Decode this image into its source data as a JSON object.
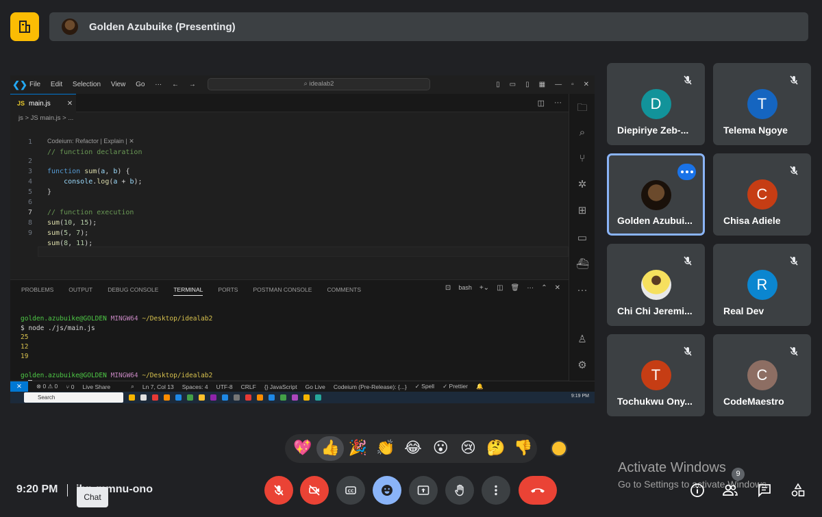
{
  "header": {
    "presenter_label": "Golden Azubuike (Presenting)"
  },
  "vscode": {
    "menu": [
      "File",
      "Edit",
      "Selection",
      "View",
      "Go",
      "···"
    ],
    "search": "idealab2",
    "tab_label": "main.js",
    "tab_badge": "JS",
    "breadcrumb": "js  >  JS  main.js  > ...",
    "codeium_lens": "Codeium: Refactor | Explain | ✕",
    "code_lines": [
      {
        "num": "1",
        "text": "// function declaration"
      },
      {
        "num": "2",
        "text": "function sum(a, b) {"
      },
      {
        "num": "3",
        "text": "    console.log(a + b);"
      },
      {
        "num": "4",
        "text": "}"
      },
      {
        "num": "5",
        "text": ""
      },
      {
        "num": "6",
        "text": "// function execution"
      },
      {
        "num": "7",
        "text": "sum(10, 15);"
      },
      {
        "num": "8",
        "text": "sum(5, 7);"
      },
      {
        "num": "9",
        "text": "sum(8, 11);"
      }
    ],
    "panel_tabs": [
      "PROBLEMS",
      "OUTPUT",
      "DEBUG CONSOLE",
      "TERMINAL",
      "PORTS",
      "POSTMAN CONSOLE",
      "COMMENTS"
    ],
    "panel_active_tab": "TERMINAL",
    "shell": "bash",
    "terminal": {
      "user": "golden.azubuike@GOLDEN",
      "env": "MINGW64",
      "path": "~/Desktop/idealab2",
      "command": "$ node ./js/main.js",
      "outputs": [
        "25",
        "12",
        "19"
      ],
      "prompt": "$"
    },
    "status_items": [
      "⊗ 0 ⚠ 0",
      "⑂ 0",
      "Live Share",
      "Ln 7, Col 13",
      "Spaces: 4",
      "UTF-8",
      "CRLF",
      "{} JavaScript",
      "Go Live",
      "Codeium (Pre-Release): {...}",
      "✓ Spell",
      "✓ Prettier"
    ],
    "taskbar_search": "Search",
    "taskbar_time": "9:19 PM"
  },
  "participants": [
    {
      "name": "Diepiriye Zeb-...",
      "initial": "D",
      "color": "#12939a",
      "muted": true
    },
    {
      "name": "Telema Ngoye",
      "initial": "T",
      "color": "#1565c0",
      "muted": true
    },
    {
      "name": "Golden Azubui...",
      "initial": "",
      "color": "#2b1a0e",
      "muted": false,
      "active": true
    },
    {
      "name": "Chisa Adiele",
      "initial": "C",
      "color": "#c63d14",
      "muted": true
    },
    {
      "name": "Chi Chi Jeremi...",
      "initial": "",
      "color": "#e8e8e8",
      "muted": true
    },
    {
      "name": "Real Dev",
      "initial": "R",
      "color": "#0b86d0",
      "muted": true
    },
    {
      "name": "Tochukwu Ony...",
      "initial": "T",
      "color": "#c63d14",
      "muted": true
    },
    {
      "name": "CodeMaestro",
      "initial": "C",
      "color": "#8d6e63",
      "muted": true
    }
  ],
  "reactions": [
    "💖",
    "👍",
    "🎉",
    "👏",
    "😂",
    "😮",
    "😢",
    "🤔",
    "👎"
  ],
  "footer": {
    "time": "9:20 PM",
    "meeting_code": "ihn-mmnu-ono",
    "tooltip": "Chat",
    "activate_title": "Activate Windows",
    "activate_sub": "Go to Settings to activate Windows.",
    "people_count": "9"
  },
  "colors": {
    "accent_blue": "#8ab4f8",
    "danger_red": "#ea4335",
    "tile_bg": "#3c4043",
    "background": "#202124",
    "logo_yellow": "#fbbc04"
  }
}
